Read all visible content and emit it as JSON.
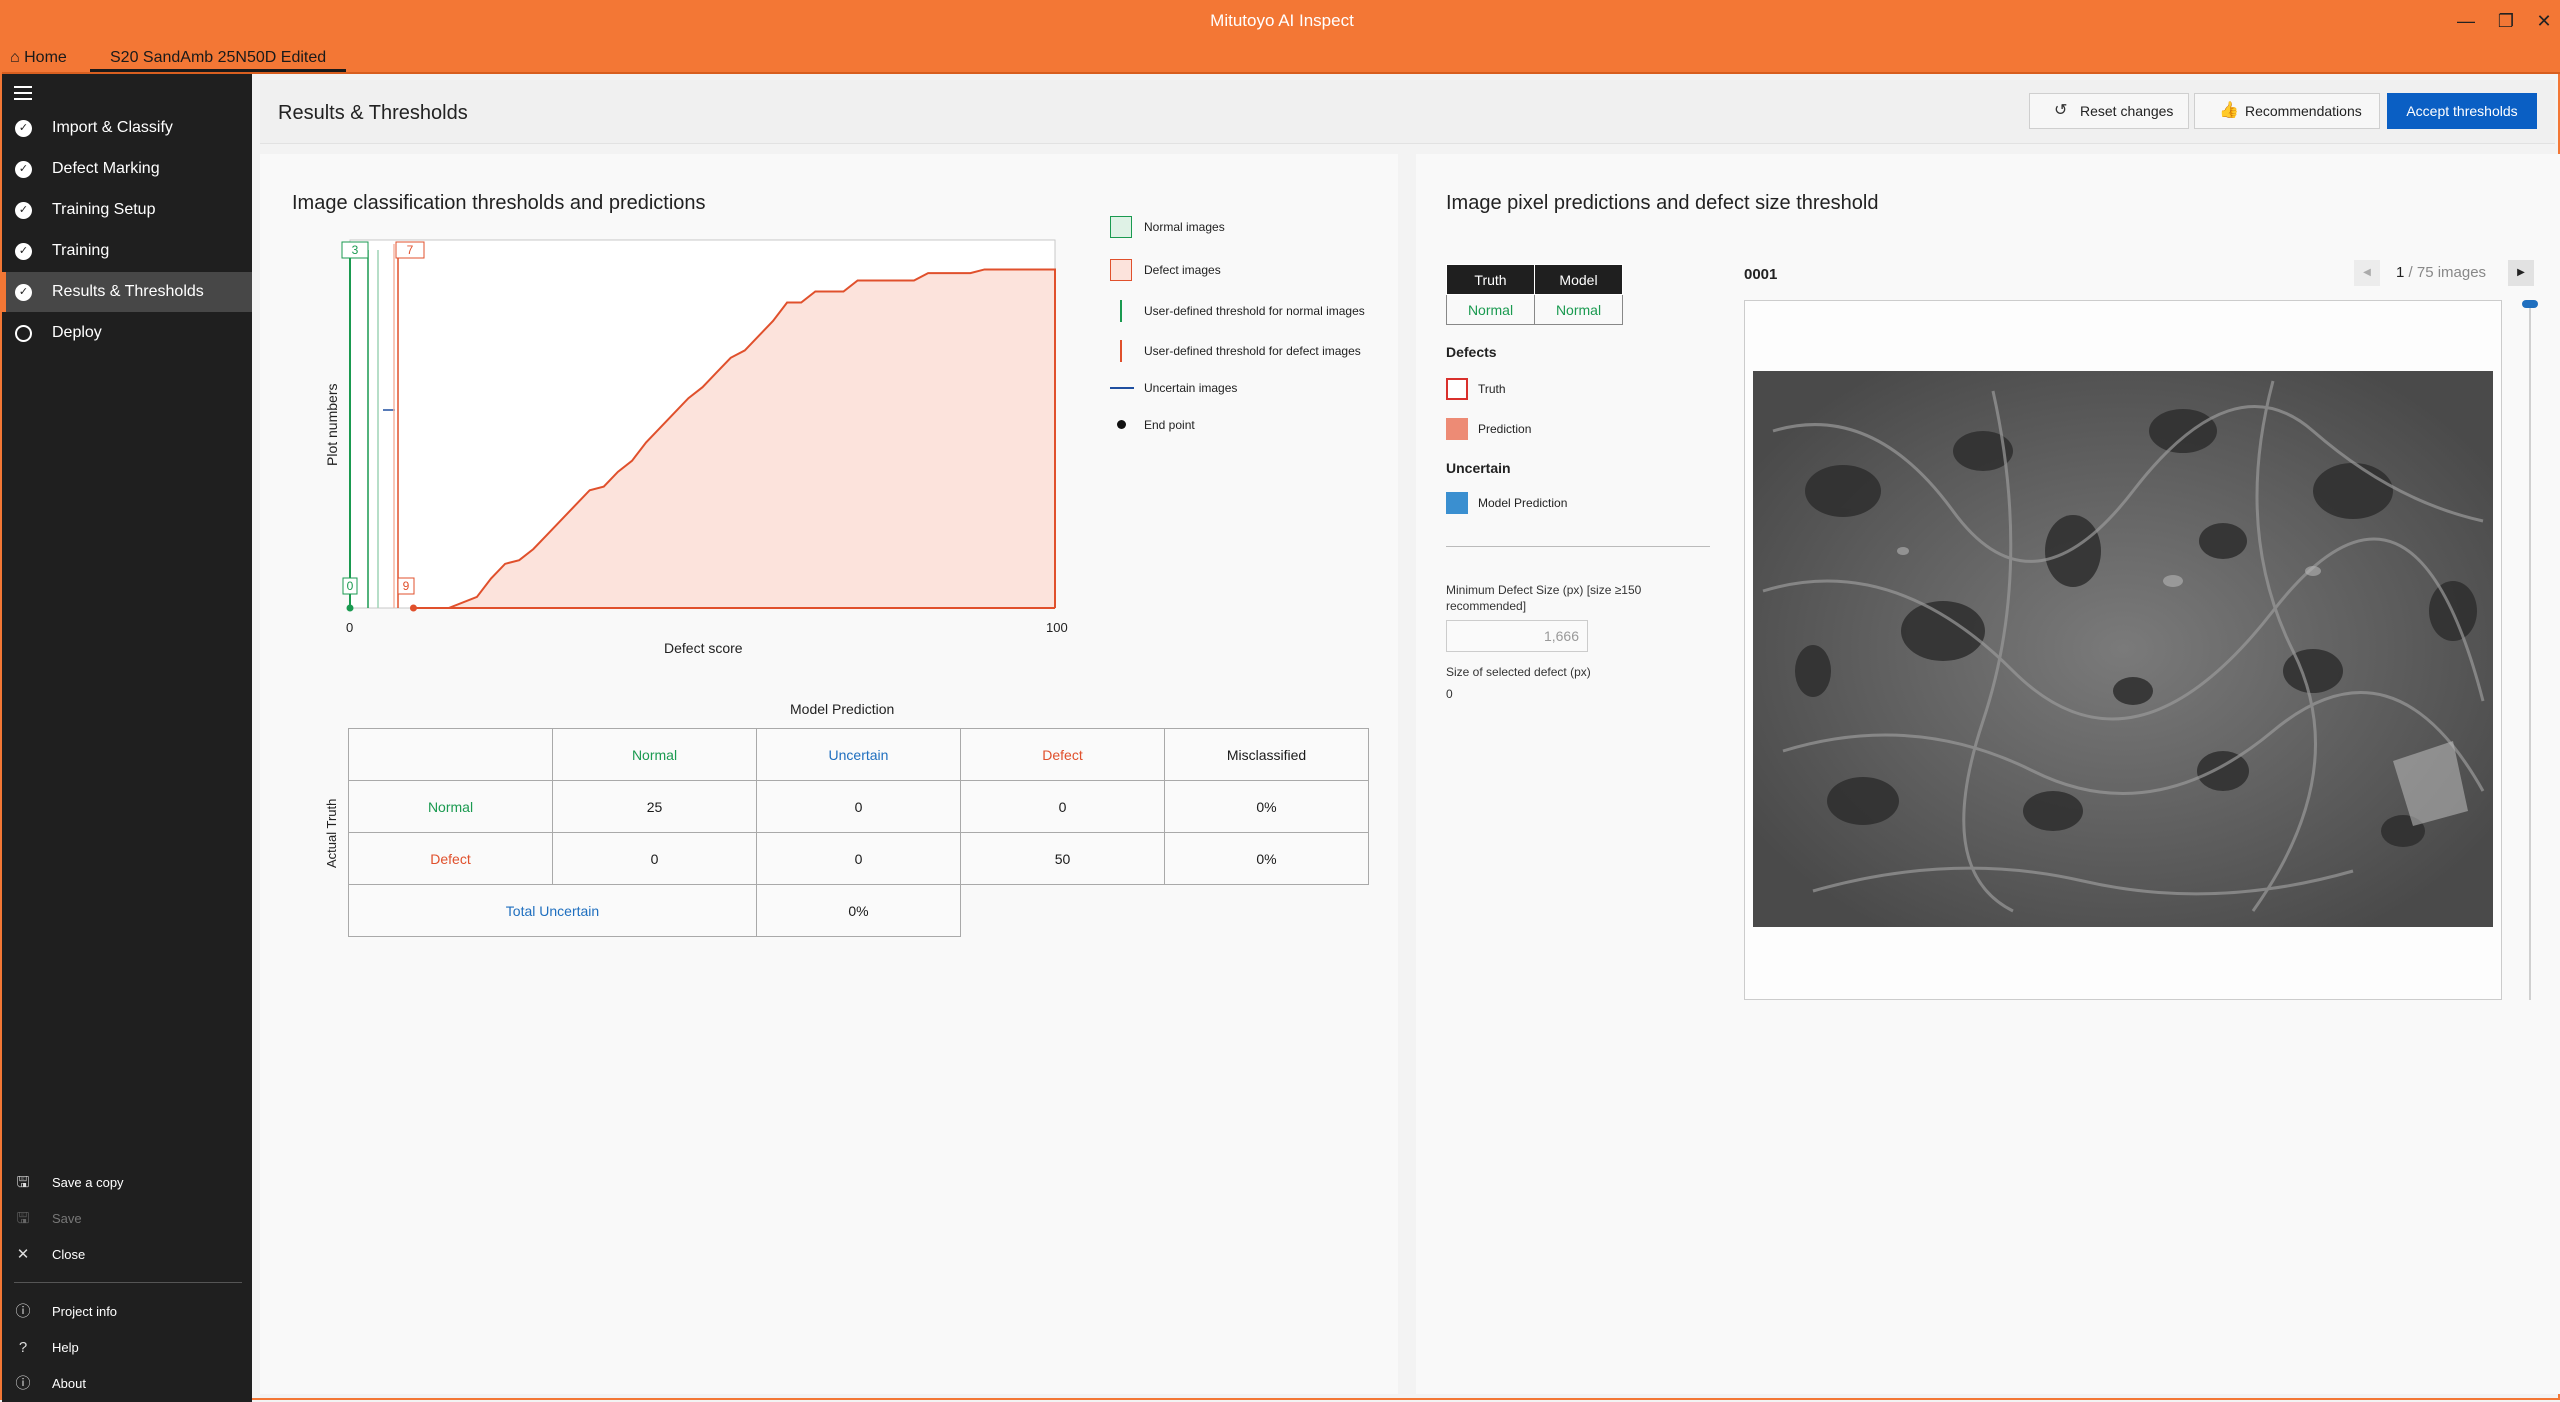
{
  "window": {
    "title": "Mitutoyo AI Inspect"
  },
  "tabs": {
    "home_label": "Home",
    "project_label": "S20 SandAmb 25N50D Edited"
  },
  "sidebar": {
    "items": [
      {
        "label": "Import & Classify",
        "state": "done"
      },
      {
        "label": "Defect Marking",
        "state": "done"
      },
      {
        "label": "Training Setup",
        "state": "done"
      },
      {
        "label": "Training",
        "state": "done"
      },
      {
        "label": "Results & Thresholds",
        "state": "active"
      },
      {
        "label": "Deploy",
        "state": "pending"
      }
    ],
    "bottom": {
      "save_copy": "Save a copy",
      "save": "Save",
      "close": "Close",
      "project_info": "Project info",
      "help": "Help",
      "about": "About"
    }
  },
  "header": {
    "title": "Results & Thresholds",
    "reset_label": "Reset changes",
    "recommendations_label": "Recommendations",
    "accept_label": "Accept thresholds"
  },
  "left_panel": {
    "title": "Image classification thresholds and predictions",
    "legend": {
      "normal_images": "Normal images",
      "defect_images": "Defect images",
      "normal_threshold": "User-defined threshold for normal images",
      "defect_threshold": "User-defined threshold for defect images",
      "uncertain_images": "Uncertain images",
      "end_point": "End point"
    },
    "confusion": {
      "title": "Model Prediction",
      "row_axis_label": "Actual Truth",
      "col_headers": [
        "Normal",
        "Uncertain",
        "Defect",
        "Misclassified"
      ],
      "rows": [
        {
          "label": "Normal",
          "values": [
            "25",
            "0",
            "0",
            "0%"
          ]
        },
        {
          "label": "Defect",
          "values": [
            "0",
            "0",
            "50",
            "0%"
          ]
        }
      ],
      "total_uncertain_label": "Total Uncertain",
      "total_uncertain_value": "0%"
    }
  },
  "chart_data": {
    "type": "area",
    "title": "",
    "xlabel": "Defect score",
    "ylabel": "Plot numbers",
    "xlim": [
      0,
      100
    ],
    "x_tick_labels": [
      "0",
      "100"
    ],
    "normal_threshold": {
      "label_top": "3",
      "label_bottom": "0",
      "x": 0
    },
    "defect_threshold": {
      "label_top": "7",
      "label_bottom": "9",
      "x": 9
    },
    "series": [
      {
        "name": "Defect images",
        "color": "#e0502c",
        "x": [
          9,
          14,
          18,
          20,
          22,
          24,
          26,
          28,
          30,
          32,
          34,
          36,
          38,
          40,
          42,
          44,
          46,
          48,
          50,
          52,
          54,
          56,
          58,
          60,
          62,
          64,
          66,
          70,
          72,
          74,
          76,
          80,
          82,
          84,
          88,
          90,
          94,
          100
        ],
        "y": [
          0,
          0,
          3,
          8,
          12,
          13,
          16,
          20,
          24,
          28,
          32,
          33,
          37,
          40,
          45,
          49,
          53,
          57,
          60,
          64,
          68,
          70,
          74,
          78,
          83,
          83,
          86,
          86,
          89,
          89,
          89,
          89,
          91,
          91,
          91,
          92,
          92,
          92
        ]
      },
      {
        "name": "Normal images",
        "color": "#1a9a50",
        "x": [
          0,
          1
        ],
        "y": [
          0,
          0
        ]
      }
    ]
  },
  "right_panel": {
    "title": "Image pixel predictions and defect size threshold",
    "truth_header": "Truth",
    "model_header": "Model",
    "truth_value": "Normal",
    "model_value": "Normal",
    "defects_heading": "Defects",
    "truth_key": "Truth",
    "prediction_key": "Prediction",
    "uncertain_heading": "Uncertain",
    "model_prediction_key": "Model Prediction",
    "min_size_label": "Minimum Defect Size (px) [size ≥150 recommended]",
    "min_size_value": "1,666",
    "selected_size_label": "Size of selected defect (px)",
    "selected_size_value": "0",
    "image_id": "0001",
    "pager_current": "1",
    "pager_total": "/ 75 images"
  }
}
